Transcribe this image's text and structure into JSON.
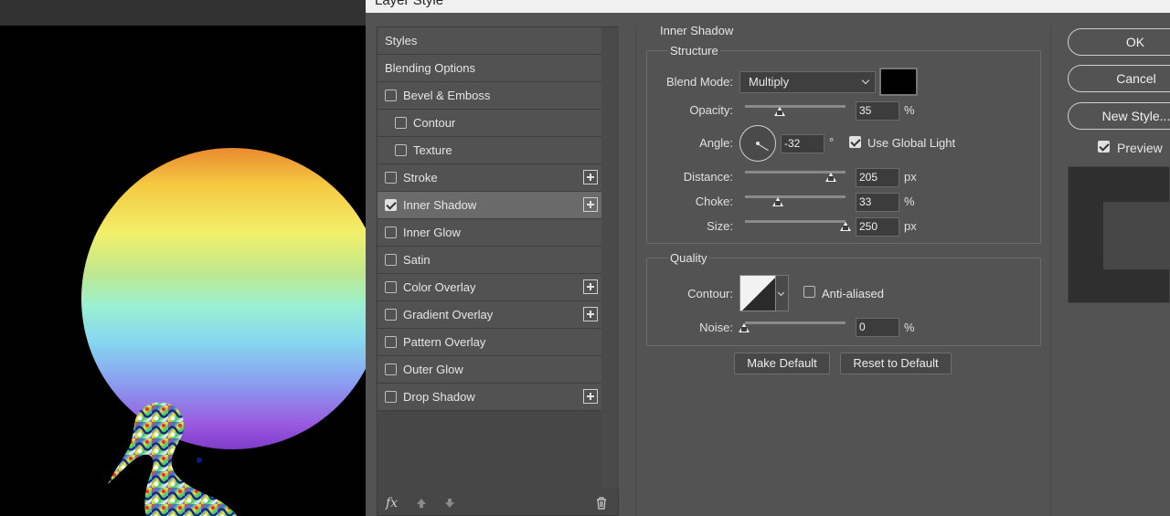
{
  "dialog": {
    "title": "Layer Style"
  },
  "styles_list": {
    "items": [
      {
        "label": "Styles",
        "checkbox": false,
        "checked": false,
        "plus": false,
        "indent": false
      },
      {
        "label": "Blending Options",
        "checkbox": false,
        "checked": false,
        "plus": false,
        "indent": false
      },
      {
        "label": "Bevel & Emboss",
        "checkbox": true,
        "checked": false,
        "plus": false,
        "indent": false
      },
      {
        "label": "Contour",
        "checkbox": true,
        "checked": false,
        "plus": false,
        "indent": true
      },
      {
        "label": "Texture",
        "checkbox": true,
        "checked": false,
        "plus": false,
        "indent": true
      },
      {
        "label": "Stroke",
        "checkbox": true,
        "checked": false,
        "plus": true,
        "indent": false
      },
      {
        "label": "Inner Shadow",
        "checkbox": true,
        "checked": true,
        "plus": true,
        "indent": false,
        "selected": true
      },
      {
        "label": "Inner Glow",
        "checkbox": true,
        "checked": false,
        "plus": false,
        "indent": false
      },
      {
        "label": "Satin",
        "checkbox": true,
        "checked": false,
        "plus": false,
        "indent": false
      },
      {
        "label": "Color Overlay",
        "checkbox": true,
        "checked": false,
        "plus": true,
        "indent": false
      },
      {
        "label": "Gradient Overlay",
        "checkbox": true,
        "checked": false,
        "plus": true,
        "indent": false
      },
      {
        "label": "Pattern Overlay",
        "checkbox": true,
        "checked": false,
        "plus": false,
        "indent": false
      },
      {
        "label": "Outer Glow",
        "checkbox": true,
        "checked": false,
        "plus": false,
        "indent": false
      },
      {
        "label": "Drop Shadow",
        "checkbox": true,
        "checked": false,
        "plus": true,
        "indent": false
      }
    ],
    "footer": {
      "fx_label": "fx",
      "up_icon": "arrow-up-icon",
      "down_icon": "arrow-down-icon",
      "trash_icon": "trash-icon"
    }
  },
  "inner_shadow": {
    "title": "Inner Shadow",
    "structure": {
      "title": "Structure",
      "blend_mode_label": "Blend Mode:",
      "blend_mode_value": "Multiply",
      "shadow_color": "#000000",
      "opacity_label": "Opacity:",
      "opacity_value": "35",
      "opacity_unit": "%",
      "angle_label": "Angle:",
      "angle_value": "-32",
      "angle_unit": "°",
      "global_light_label": "Use Global Light",
      "global_light_checked": true,
      "distance_label": "Distance:",
      "distance_value": "205",
      "distance_unit": "px",
      "choke_label": "Choke:",
      "choke_value": "33",
      "choke_unit": "%",
      "size_label": "Size:",
      "size_value": "250",
      "size_unit": "px"
    },
    "quality": {
      "title": "Quality",
      "contour_label": "Contour:",
      "anti_aliased_label": "Anti-aliased",
      "anti_aliased_checked": false,
      "noise_label": "Noise:",
      "noise_value": "0",
      "noise_unit": "%"
    },
    "make_default_label": "Make Default",
    "reset_default_label": "Reset to Default"
  },
  "actions": {
    "ok_label": "OK",
    "cancel_label": "Cancel",
    "new_style_label": "New Style...",
    "preview_label": "Preview",
    "preview_checked": true
  }
}
